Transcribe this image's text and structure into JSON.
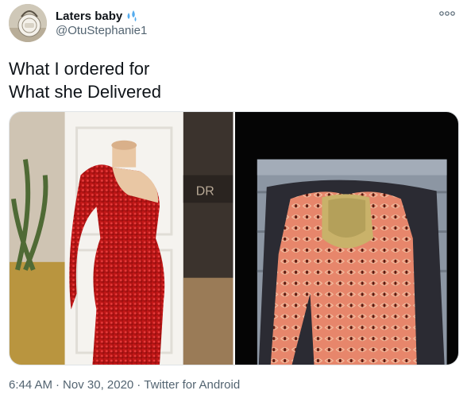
{
  "author": {
    "display_name": "Laters baby",
    "handle": "@OtuStephanie1",
    "name_emoji": "droplets-emoji"
  },
  "header": {
    "more_icon": "more-horizontal-icon"
  },
  "tweet": {
    "line1": "What I ordered for",
    "line2": "What she Delivered"
  },
  "media": {
    "left_photo_wall_text": "DR"
  },
  "meta": {
    "time": "6:44 AM",
    "separator": "·",
    "date": "Nov 30, 2020",
    "source": "Twitter for Android"
  },
  "colors": {
    "text_primary": "#0f1419",
    "text_secondary": "#536471",
    "emoji_blue": "#55acee"
  }
}
